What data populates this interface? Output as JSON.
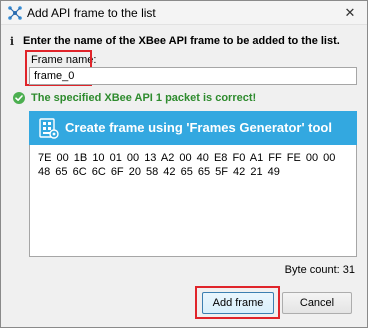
{
  "window": {
    "title": "Add API frame to the list",
    "close_glyph": "✕"
  },
  "info": {
    "icon": "i",
    "text": "Enter the name of the XBee API frame to be added to the list."
  },
  "frame_name": {
    "label": "Frame name:",
    "value": "frame_0"
  },
  "status": {
    "text": "The specified XBee API 1 packet is correct!",
    "color": "#2e8b2e"
  },
  "generator": {
    "label": "Create frame using 'Frames Generator' tool",
    "color": "#33a8e0"
  },
  "hex_content": "7E 00 1B 10 01 00 13 A2 00 40 E8 F0 A1 FF FE 00 00 48 65 6C 6C 6F 20 58 42 65 65 5F 42 21 49",
  "byte_count": "Byte count: 31",
  "buttons": {
    "add": "Add frame",
    "cancel": "Cancel"
  },
  "highlight_color": "#e0242a"
}
